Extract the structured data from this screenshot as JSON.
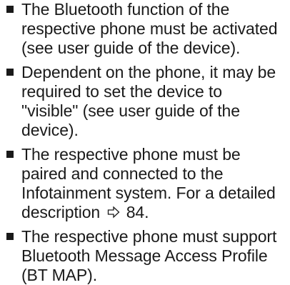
{
  "bullets": [
    {
      "lines": [
        "The Bluetooth function of the",
        "respective phone must be activated",
        "(see user guide of the device)."
      ]
    },
    {
      "lines": [
        "Dependent on the phone, it may be",
        "required to set the device to",
        "\"visible\" (see user guide of the",
        "device)."
      ]
    },
    {
      "lines": [
        "The respective phone must be",
        "paired and connected to the",
        "Infotainment system. For a detailed"
      ],
      "last_line_prefix": "description",
      "page_reference_icon": "page-reference-arrow-icon",
      "page_reference": "84."
    },
    {
      "lines": [
        "The respective phone must support",
        "Bluetooth Message Access Profile",
        "(BT MAP)."
      ]
    }
  ]
}
